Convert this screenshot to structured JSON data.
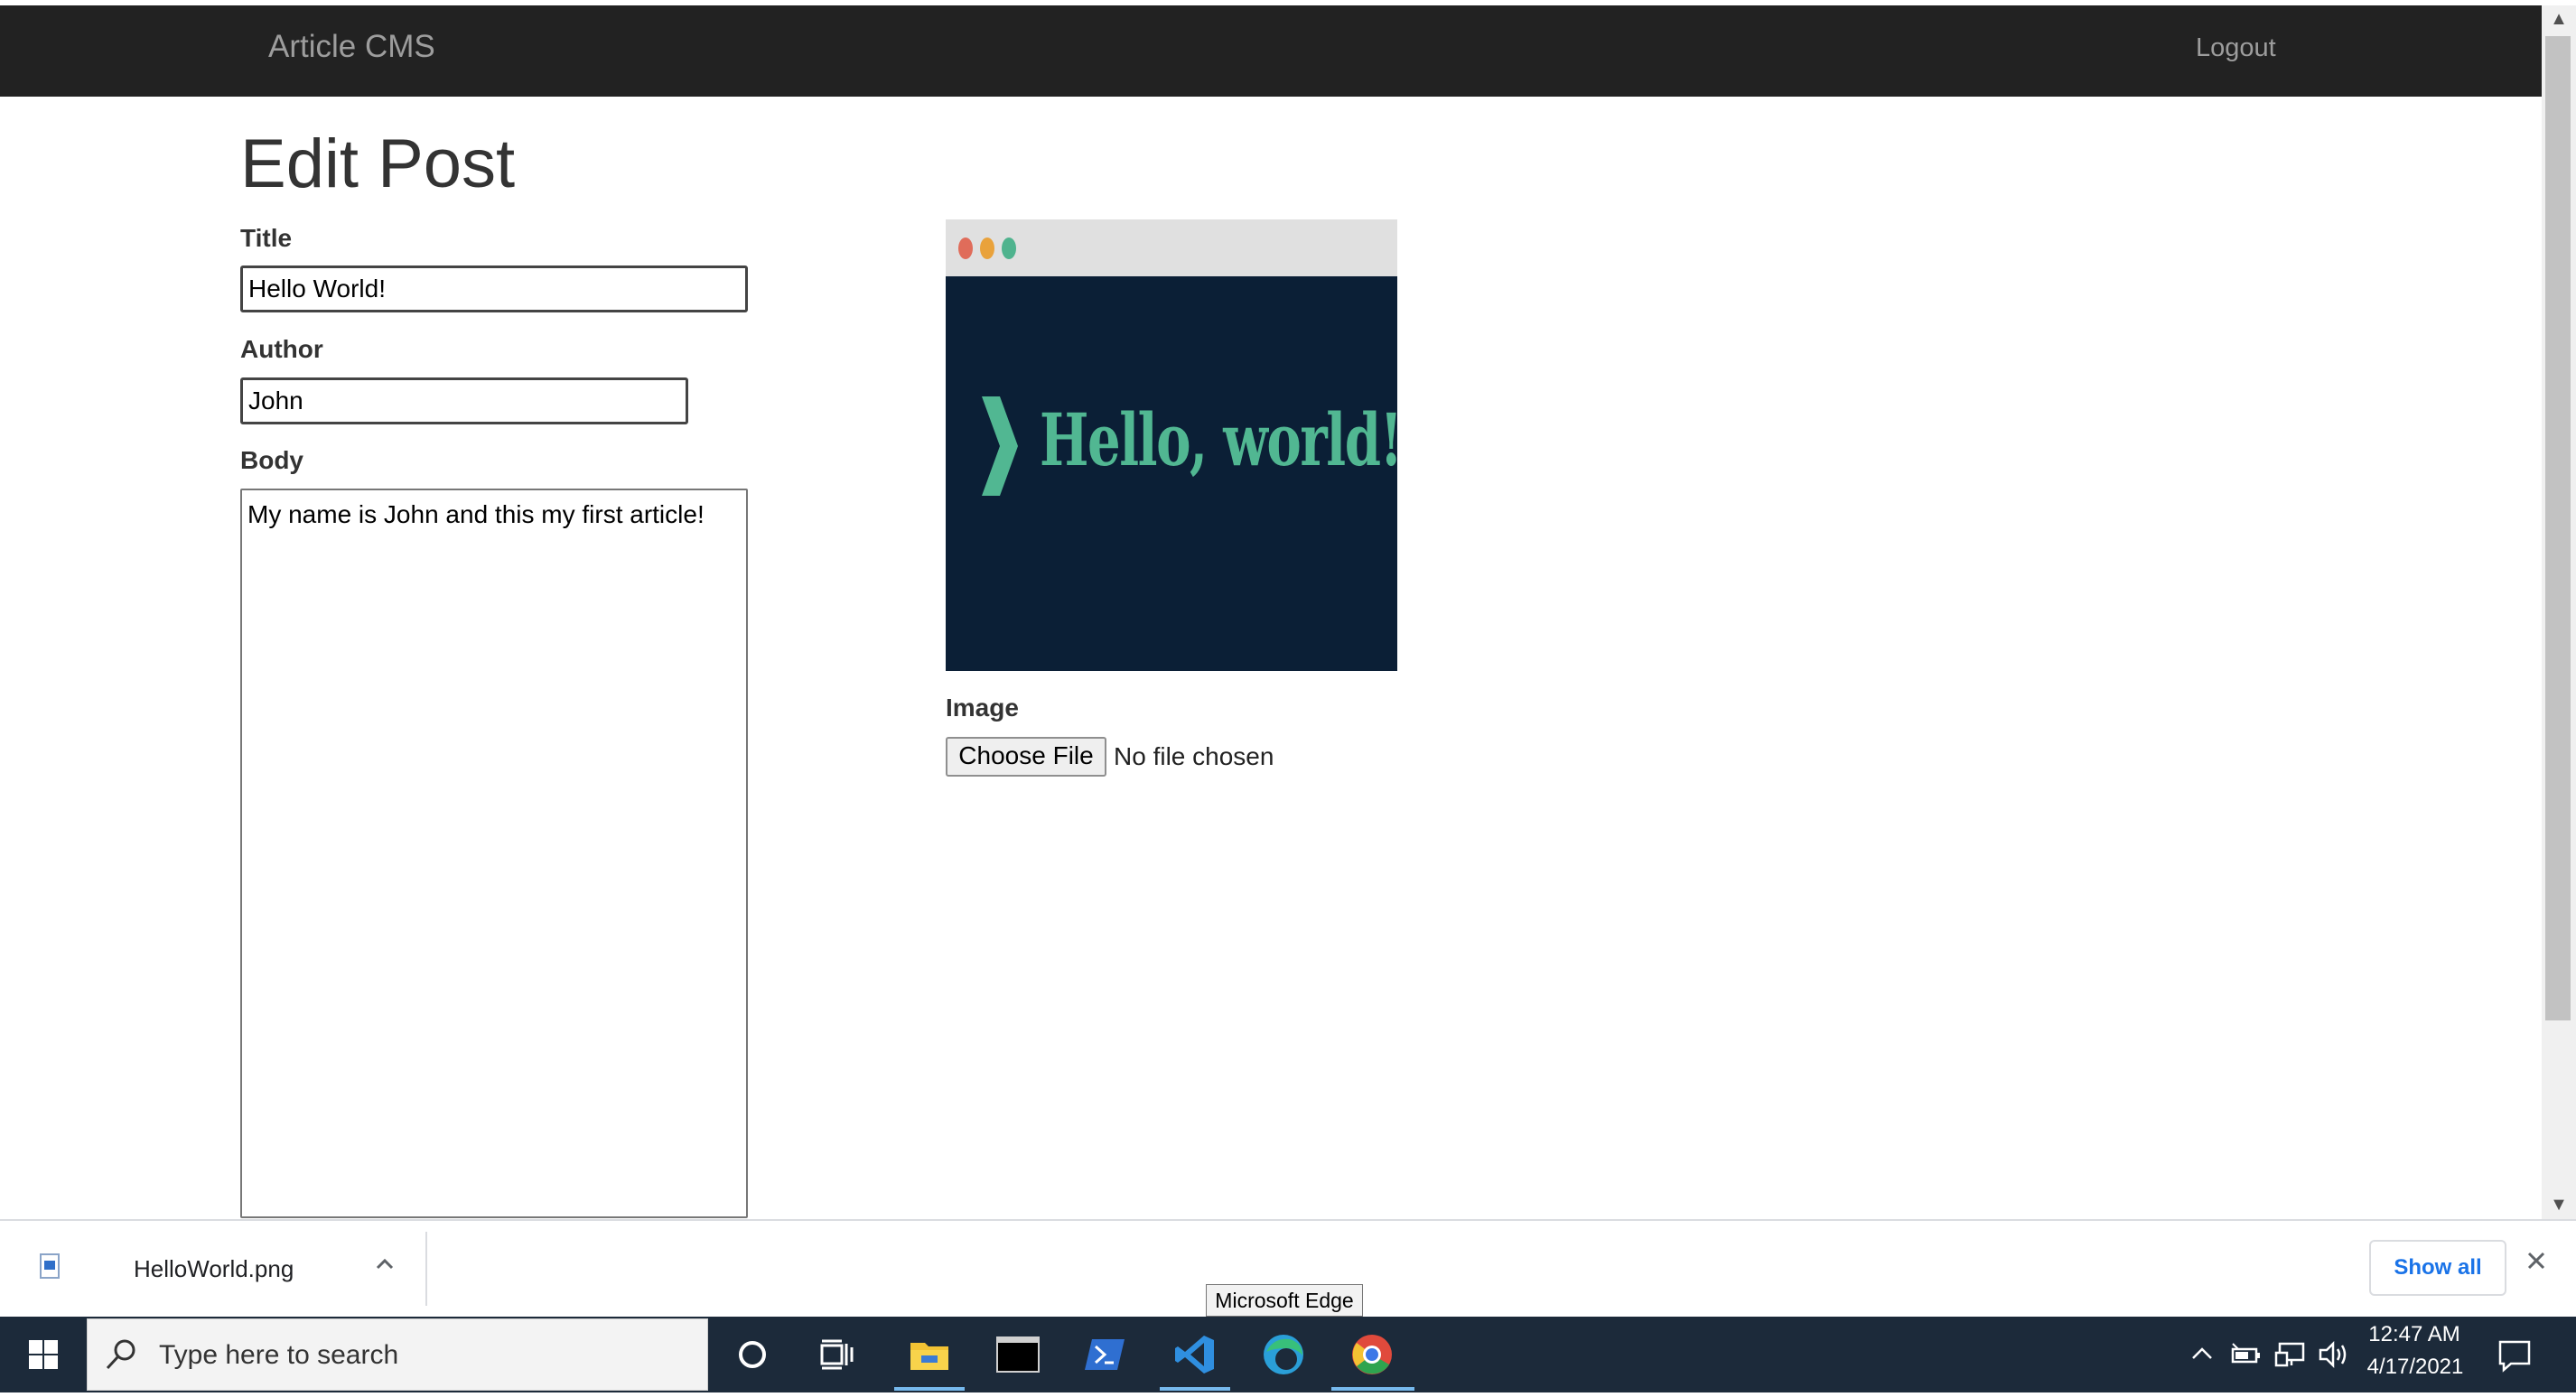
{
  "navbar": {
    "brand": "Article CMS",
    "logout": "Logout"
  },
  "page": {
    "title": "Edit Post"
  },
  "form": {
    "title_label": "Title",
    "title_value": "Hello World!",
    "author_label": "Author",
    "author_value": "John",
    "body_label": "Body",
    "body_value": "My name is John and this my first article!",
    "image_label": "Image",
    "choose_file": "Choose File",
    "no_file": "No file chosen"
  },
  "preview": {
    "text": "Hello, world!_"
  },
  "download_bar": {
    "filename": "HelloWorld.png",
    "show_all": "Show all"
  },
  "tooltip": {
    "text": "Microsoft Edge"
  },
  "taskbar": {
    "search_placeholder": "Type here to search",
    "time": "12:47 AM",
    "date": "4/17/2021",
    "apps": [
      "cortana-icon",
      "task-view-icon",
      "file-explorer-icon",
      "terminal-icon",
      "powershell-icon",
      "vscode-icon",
      "edge-icon",
      "chrome-icon"
    ]
  },
  "colors": {
    "navbar": "#222222",
    "preview_bg": "#0b1f36",
    "preview_accent": "#51b792",
    "taskbar": "#1c2a3a"
  }
}
